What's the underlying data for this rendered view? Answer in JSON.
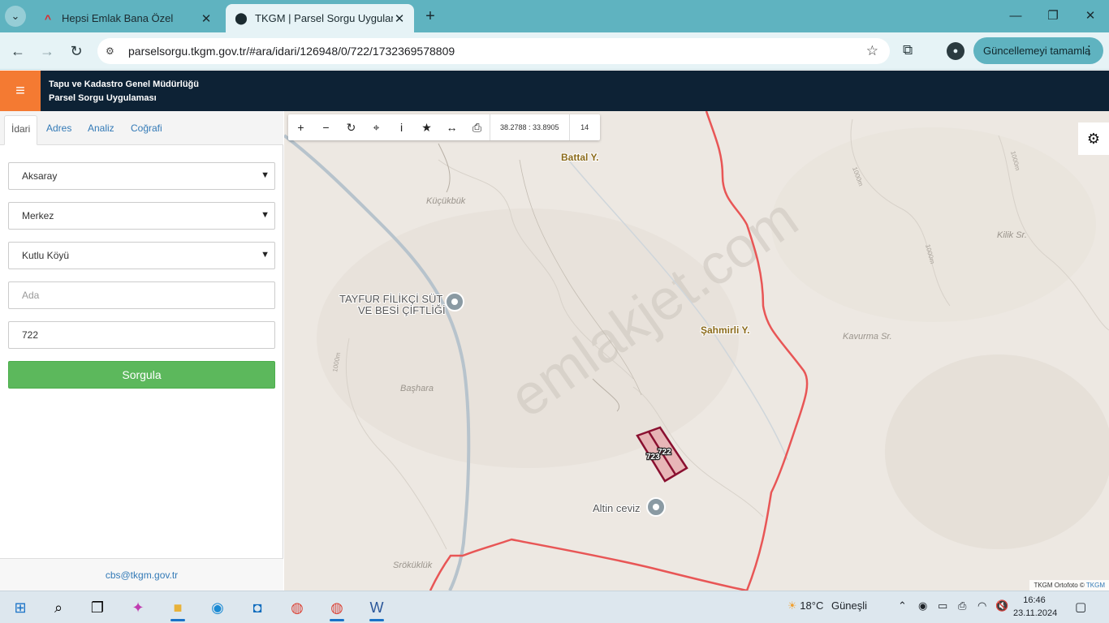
{
  "browser": {
    "tabs": [
      {
        "title": "Hepsi Emlak Bana Özel",
        "favicon": "hepsiemlak-logo-icon"
      },
      {
        "title": "TKGM | Parsel Sorgu Uygulaması",
        "favicon": "location-pin-icon"
      }
    ],
    "url": "parselsorgu.tkgm.gov.tr/#ara/idari/126948/0/722/1732369578809",
    "update_button": "Güncellemeyi tamamla"
  },
  "app": {
    "title_line1": "Tapu ve Kadastro Genel Müdürlüğü",
    "title_line2": "Parsel Sorgu Uygulaması",
    "accent": "#f47a32",
    "header_bg": "#0d2235"
  },
  "panel": {
    "tabs": [
      "İdari",
      "Adres",
      "Analiz",
      "Coğrafi"
    ],
    "active_tab": "İdari",
    "il": "Aksaray",
    "ilce": "Merkez",
    "mahalle": "Kutlu Köyü",
    "ada_placeholder": "Ada",
    "parsel_value": "722",
    "submit_label": "Sorgula",
    "footer_email": "cbs@tkgm.gov.tr"
  },
  "map": {
    "coordinates": "38.2788 : 33.8905",
    "zoom_level": "14",
    "labels": {
      "battal": "Battal Y.",
      "kucukbuk": "Küçükbük",
      "kilik": "Kilik Sr.",
      "tayfur1": "TAYFUR FİLİKÇİ SÜT",
      "tayfur2": "VE BESİ ÇİFTLİĞİ",
      "sahmirli": "Şahmirli Y.",
      "kavurma": "Kavurma Sr.",
      "bashara": "Başhara",
      "altin_ceviz": "Altin ceviz",
      "parcel_722": "722",
      "parcel_723": "723",
      "contour_1000": "1000m",
      "bottom_label": "Sröküklük"
    },
    "watermark": "emlakjet.com",
    "attribution_prefix": "TKGM Ortofoto ©",
    "attribution_link": "TKGM"
  },
  "taskbar": {
    "weather_temp": "18°C",
    "weather_text": "Güneşli",
    "time": "16:46",
    "date": "23.11.2024"
  }
}
